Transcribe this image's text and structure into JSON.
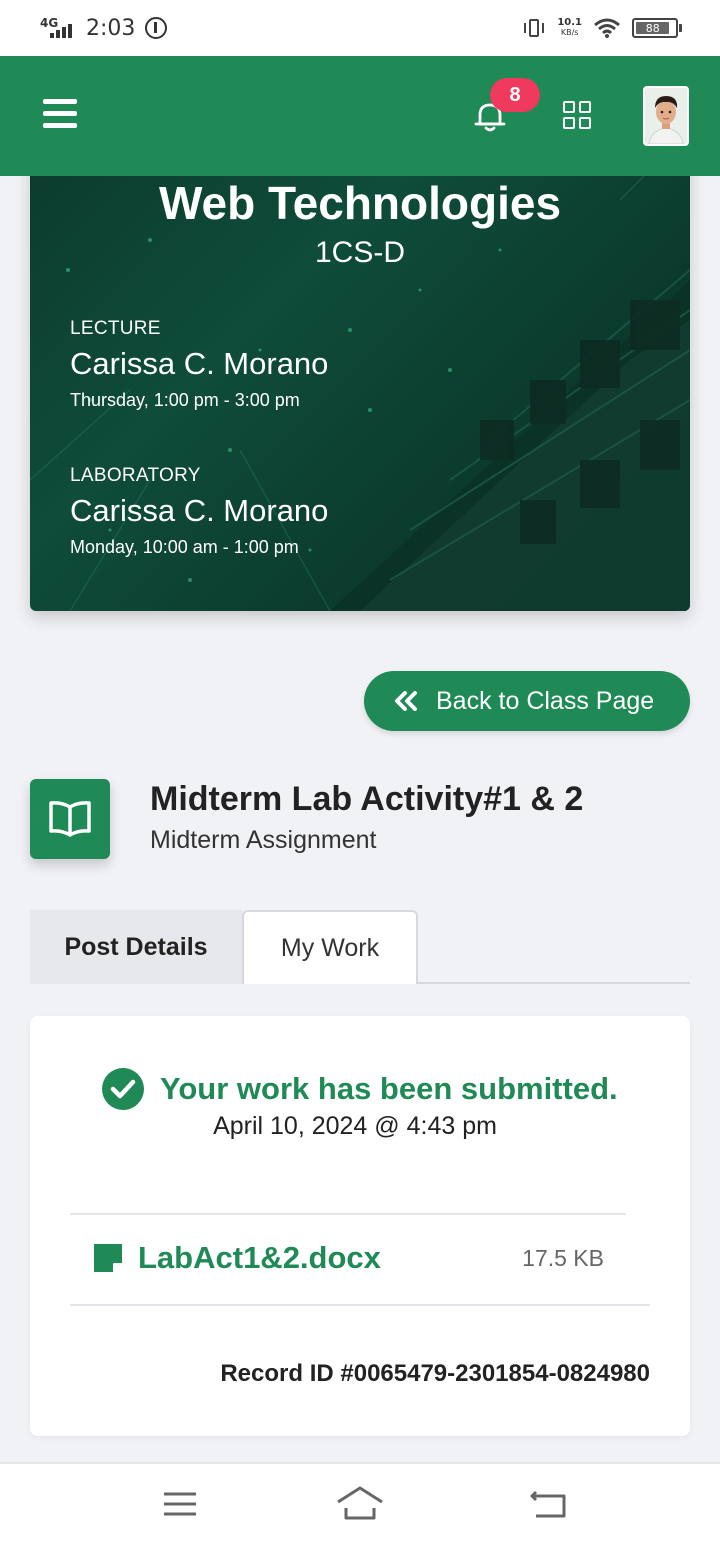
{
  "status_bar": {
    "network": "4G",
    "time": "2:03",
    "speed_value": "10.1",
    "speed_unit": "KB/s",
    "battery": "88"
  },
  "header": {
    "notification_count": "8",
    "accent_color": "#1f8a55",
    "badge_color": "#ef3a5d"
  },
  "course": {
    "title": "Web Technologies",
    "section": "1CS-D",
    "lecture": {
      "kind": "LECTURE",
      "instructor": "Carissa C. Morano",
      "schedule": "Thursday, 1:00 pm - 3:00 pm"
    },
    "laboratory": {
      "kind": "LABORATORY",
      "instructor": "Carissa C. Morano",
      "schedule": "Monday, 10:00 am - 1:00 pm"
    }
  },
  "actions": {
    "back_label": "Back to Class Page"
  },
  "post": {
    "title": "Midterm Lab Activity#1 & 2",
    "subtitle": "Midterm Assignment"
  },
  "tabs": [
    {
      "label": "Post Details",
      "active": false
    },
    {
      "label": "My Work",
      "active": true
    }
  ],
  "work": {
    "status": "Your work has been submitted.",
    "submitted_at": "April 10, 2024 @ 4:43 pm",
    "file": {
      "name": "LabAct1&2.docx",
      "size": "17.5 KB"
    },
    "record_id": "Record ID #0065479-2301854-0824980"
  }
}
